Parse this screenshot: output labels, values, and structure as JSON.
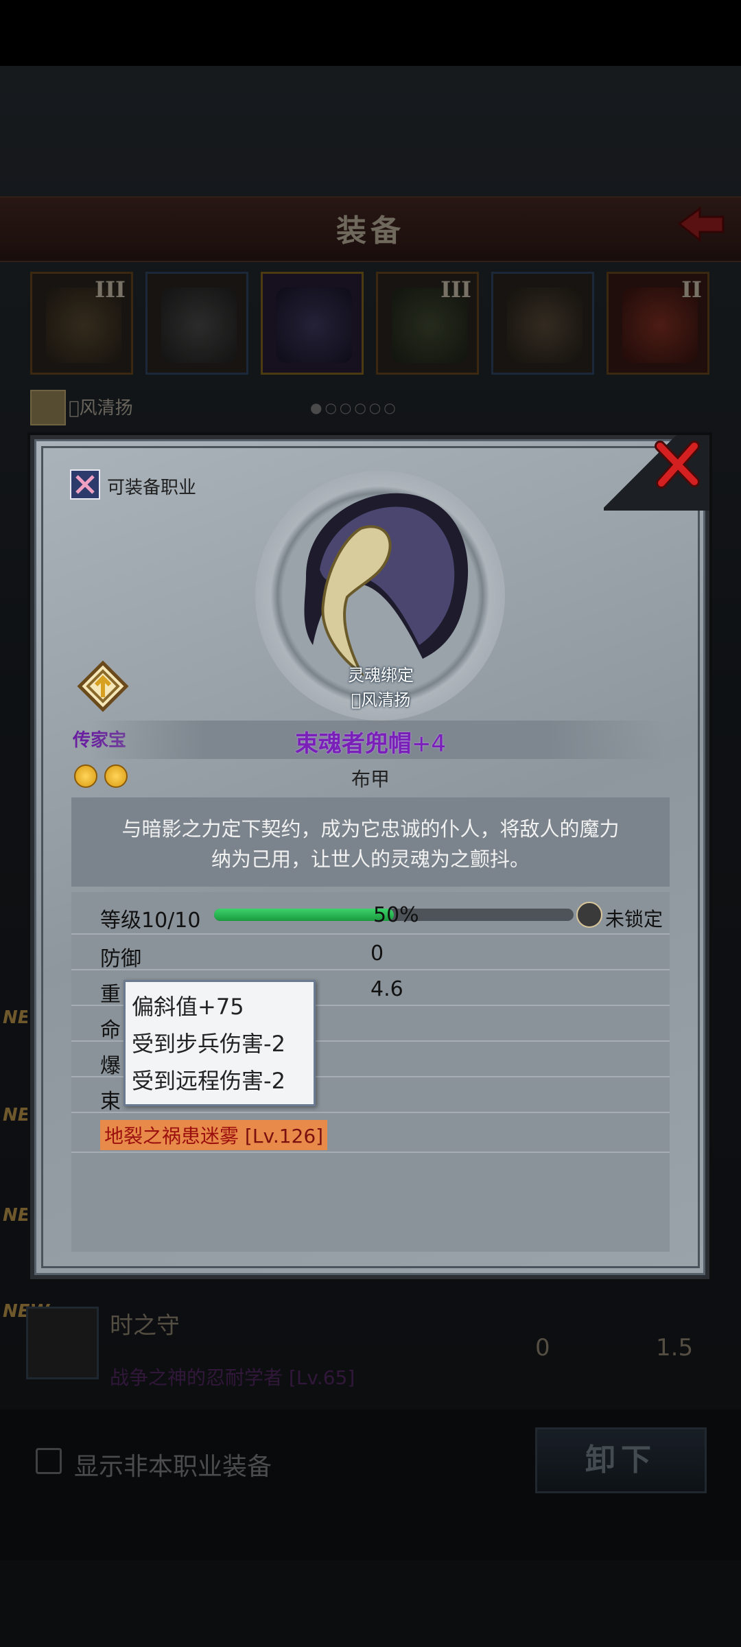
{
  "header": {
    "title": "装备"
  },
  "slots": [
    {
      "tier": "III",
      "icon": "pauldron-icon"
    },
    {
      "tier": "",
      "icon": "gauntlet-icon"
    },
    {
      "tier": "",
      "icon": "hood-icon"
    },
    {
      "tier": "III",
      "icon": "chest-armor-icon"
    },
    {
      "tier": "",
      "icon": "boots-icon"
    },
    {
      "tier": "II",
      "icon": "knot-charm-icon"
    }
  ],
  "owner": {
    "name": "\u0000风清扬"
  },
  "background_list": {
    "new_tags": [
      "NEW",
      "NEW",
      "NEW",
      "NEW"
    ],
    "item": {
      "name": "时之守",
      "subtitle": "战争之神的忍耐学者 [Lv.65]",
      "col1": "0",
      "col2": "1.5"
    }
  },
  "bottom": {
    "checkbox_label": "显示非本职业装备",
    "unequip_label": "卸下"
  },
  "popup": {
    "job_label": "可装备职业",
    "bound_label": "灵魂绑定",
    "bound_owner": "\u0000风清扬",
    "heirloom_label": "传家宝",
    "item_name": "束魂者兜帽",
    "item_plus": "+4",
    "item_type": "布甲",
    "description_line1": "与暗影之力定下契约，成为它忠诚的仆人，将敌人的魔力",
    "description_line2": "纳为己用，让世人的灵魂为之颤抖。",
    "level_label": "等级",
    "level_value": "10/10",
    "level_percent_text": "50%",
    "level_fraction": 0.5,
    "lock_label": "未锁定",
    "stats": [
      {
        "label": "防御",
        "value": "0"
      },
      {
        "label": "重",
        "value": "4.6"
      },
      {
        "label": "命",
        "value": ""
      },
      {
        "label": "爆",
        "value": ""
      },
      {
        "label": "束",
        "value": ""
      }
    ],
    "tooltip_lines": [
      {
        "label": "偏斜值",
        "value": "+75"
      },
      {
        "label": "受到步兵伤害",
        "value": "-2"
      },
      {
        "label": "受到远程伤害",
        "value": "-2"
      }
    ],
    "set_name": "地裂之祸患迷雾",
    "set_level": "[Lv.126]"
  },
  "colors": {
    "item_name": "#7a1fb8",
    "level_fill": "#2cbf58",
    "set_name_bg": "#e88a4a"
  }
}
